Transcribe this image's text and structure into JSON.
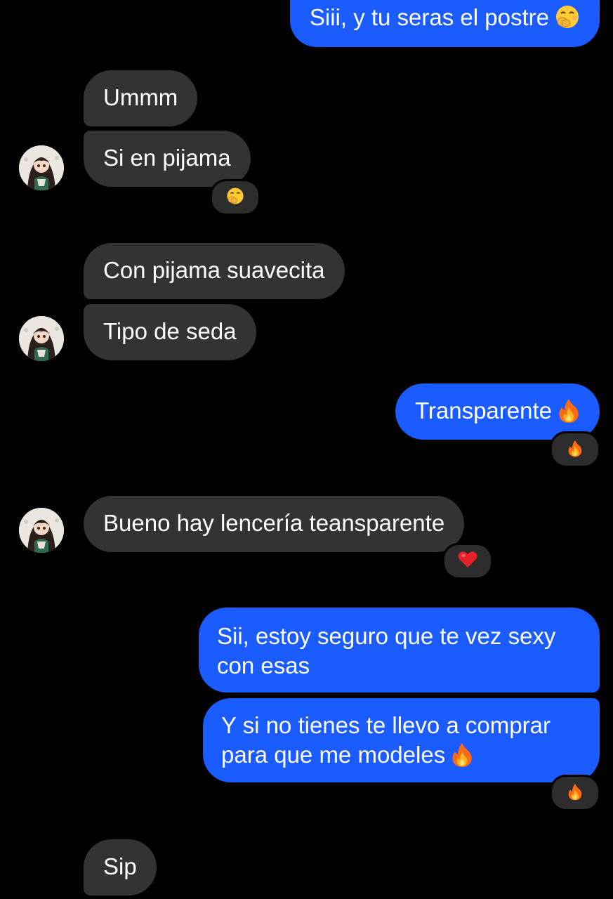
{
  "conversation": {
    "messages": [
      {
        "from": "me",
        "text": "Siii, y tu seras el postre",
        "emoji": "hand-over-mouth-emoji"
      },
      {
        "from": "them",
        "text": "Ummm"
      },
      {
        "from": "them",
        "text": "Si en pijama",
        "reaction": "hand-over-mouth-emoji"
      },
      {
        "from": "them",
        "text": "Con pijama suavecita"
      },
      {
        "from": "them",
        "text": "Tipo de seda"
      },
      {
        "from": "me",
        "text": "Transparente",
        "emoji": "fire-emoji",
        "reaction": "fire-emoji"
      },
      {
        "from": "them",
        "text": "Bueno hay lencería teansparente",
        "reaction": "red-heart-emoji"
      },
      {
        "from": "me",
        "text": "Sii, estoy seguro que te vez sexy con esas"
      },
      {
        "from": "me",
        "text": "Y si no tienes te llevo a comprar para que me modeles",
        "emoji": "fire-emoji",
        "reaction": "fire-emoji"
      },
      {
        "from": "them",
        "text": "Sip"
      }
    ]
  },
  "colors": {
    "background": "#000000",
    "outgoing_bubble": "#1a5cff",
    "incoming_bubble": "#333333",
    "reaction_pill": "#2d2d2d",
    "text": "#ffffff"
  }
}
